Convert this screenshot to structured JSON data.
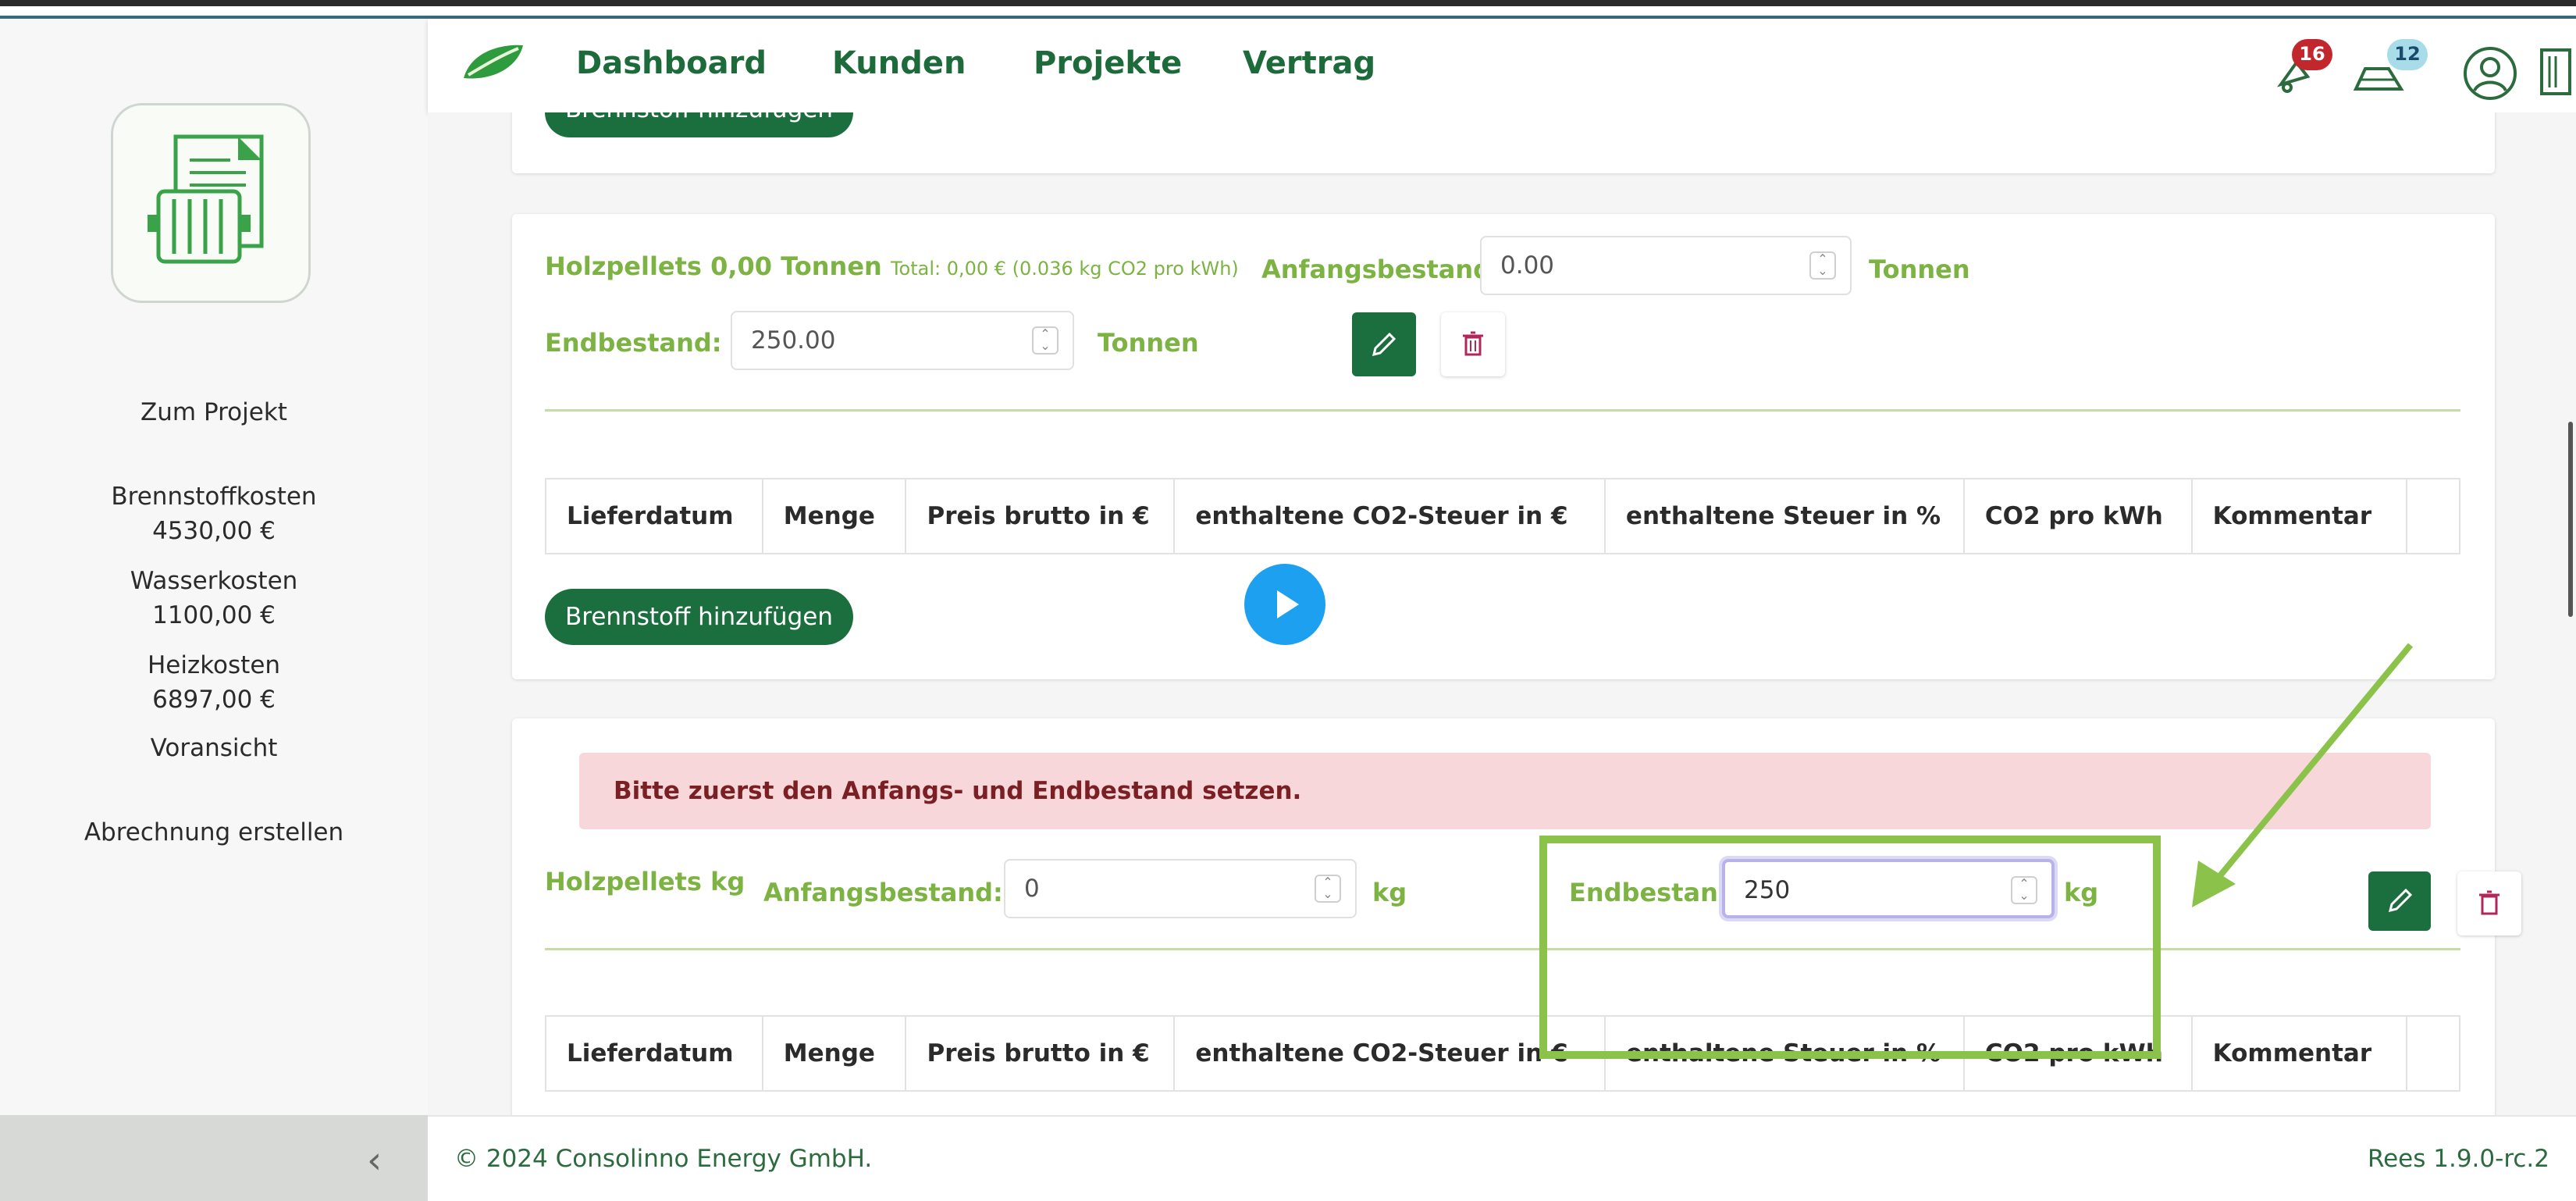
{
  "header": {
    "nav": [
      "Dashboard",
      "Kunden",
      "Projekte",
      "Vertrag"
    ],
    "notifications_count": "16",
    "messages_count": "12"
  },
  "sidebar": {
    "link_project": "Zum Projekt",
    "costs": [
      {
        "label": "Brennstoffkosten",
        "value": "4530,00 €"
      },
      {
        "label": "Wasserkosten",
        "value": "1100,00 €"
      },
      {
        "label": "Heizkosten",
        "value": "6897,00 €"
      }
    ],
    "preview": "Voransicht",
    "create_invoice": "Abrechnung erstellen"
  },
  "top_card": {
    "button": "Brennstoff hinzufügen"
  },
  "card1": {
    "title": "Holzpellets 0,00 Tonnen",
    "subtitle": "Total: 0,00 € (0.036 kg CO2 pro kWh)",
    "start_label": "Anfangsbestand:",
    "start_value": "0.00",
    "start_unit": "Tonnen",
    "end_label": "Endbestand:",
    "end_value": "250.00",
    "end_unit": "Tonnen",
    "table_headers": [
      "Lieferdatum",
      "Menge",
      "Preis brutto in €",
      "enthaltene CO2-Steuer in €",
      "enthaltene Steuer in %",
      "CO2 pro kWh",
      "Kommentar"
    ],
    "add_button": "Brennstoff hinzufügen"
  },
  "card2": {
    "alert": "Bitte zuerst den Anfangs- und Endbestand setzen.",
    "title": "Holzpellets kg",
    "start_label": "Anfangsbestand:",
    "start_value": "0",
    "start_unit": "kg",
    "end_label": "Endbestand:",
    "end_value": "250",
    "end_unit": "kg",
    "table_headers": [
      "Lieferdatum",
      "Menge",
      "Preis brutto in €",
      "enthaltene CO2-Steuer in €",
      "enthaltene Steuer in %",
      "CO2 pro kWh",
      "Kommentar"
    ]
  },
  "footer": {
    "copyright": "© 2024 Consolinno Energy GmbH.",
    "version": "Rees 1.9.0-rc.2"
  },
  "colors": {
    "brand_green": "#1b6e3e",
    "label_green": "#7cb342",
    "highlight": "#8bc34a",
    "alert_bg": "#f8d7da",
    "play_blue": "#1ea0f0"
  }
}
